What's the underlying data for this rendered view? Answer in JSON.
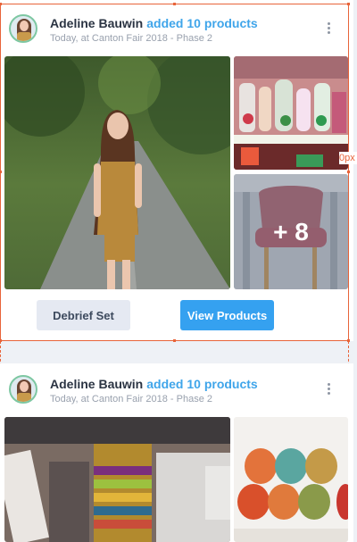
{
  "posts": [
    {
      "user": "Adeline Bauwin",
      "action": "added 10 products",
      "subtitle": "Today, at Canton Fair 2018 - Phase 2",
      "more_count": "+ 8",
      "buttons": {
        "debrief": "Debrief Set",
        "view": "View Products"
      }
    },
    {
      "user": "Adeline Bauwin",
      "action": "added 10 products",
      "subtitle": "Today, at Canton Fair 2018 - Phase 2"
    }
  ],
  "overlay_label": "0px",
  "icons": {
    "menu": "more-vertical-icon",
    "avatar": "user-avatar"
  },
  "colors": {
    "accent": "#35a1f0",
    "selection": "#e8643a",
    "secondary_btn": "#e5e9f2"
  }
}
